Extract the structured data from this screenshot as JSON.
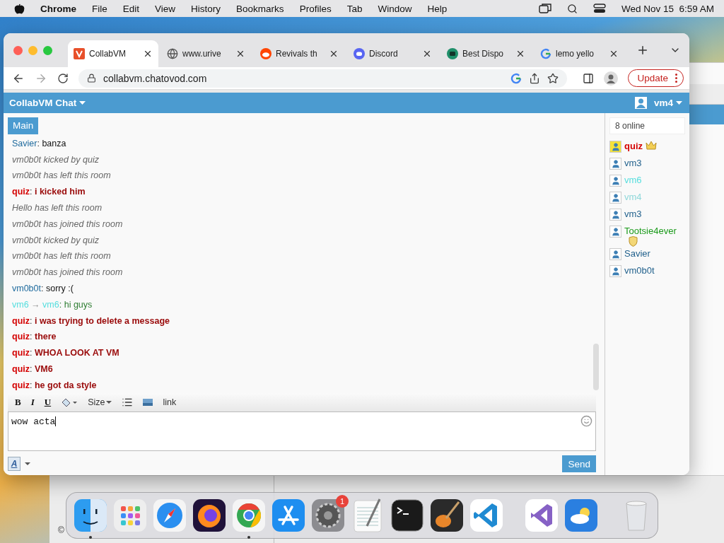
{
  "menubar": {
    "app": "Chrome",
    "menus": [
      "File",
      "Edit",
      "View",
      "History",
      "Bookmarks",
      "Profiles",
      "Tab",
      "Window",
      "Help"
    ],
    "clock": "Wed Nov 15  6:59 AM"
  },
  "browser": {
    "tabs": [
      {
        "title": "CollabVM",
        "kind": "collabvm",
        "selected": true
      },
      {
        "title": "www.urive",
        "kind": "globe",
        "selected": false
      },
      {
        "title": "Revivals th",
        "kind": "reddit",
        "selected": false
      },
      {
        "title": "Discord",
        "kind": "discord",
        "selected": false
      },
      {
        "title": "Best Dispo",
        "kind": "bot",
        "selected": false
      },
      {
        "title": "lemo yello",
        "kind": "google",
        "selected": false
      }
    ],
    "url": "collabvm.chatovod.com",
    "update_label": "Update"
  },
  "chat": {
    "title": "CollabVM Chat",
    "user": "vm4",
    "room_tabs": [
      {
        "label": "Main",
        "selected": true
      }
    ],
    "messages": [
      {
        "kind": "chat",
        "author": "Savier",
        "color": "#1f6b9e",
        "separator": ":",
        "text": "banza"
      },
      {
        "kind": "system",
        "text": "vm0b0t kicked by quiz"
      },
      {
        "kind": "system",
        "text": "vm0b0t has left this room"
      },
      {
        "kind": "admin",
        "author": "quiz",
        "color": "#d40000",
        "separator": ":",
        "text": "i kicked him"
      },
      {
        "kind": "system",
        "text": "Hello has left this room"
      },
      {
        "kind": "system",
        "text": "vm0b0t has joined this room"
      },
      {
        "kind": "system",
        "text": "vm0b0t kicked by quiz"
      },
      {
        "kind": "system",
        "text": "vm0b0t has left this room"
      },
      {
        "kind": "system",
        "text": "vm0b0t has joined this room"
      },
      {
        "kind": "chat",
        "author": "vm0b0t",
        "color": "#1f6b9e",
        "separator": ":",
        "text": "sorry :("
      },
      {
        "kind": "whisper",
        "author": "vm6",
        "arrow": "→",
        "recipient": "vm6",
        "color": "#55dede",
        "separator": ":",
        "text": "hi guys"
      },
      {
        "kind": "admin",
        "author": "quiz",
        "color": "#d40000",
        "separator": ":",
        "text": "i was trying to delete a message"
      },
      {
        "kind": "admin",
        "author": "quiz",
        "color": "#d40000",
        "separator": ":",
        "text": "there"
      },
      {
        "kind": "admin",
        "author": "quiz",
        "color": "#d40000",
        "separator": ":",
        "text": "WHOA LOOK AT VM"
      },
      {
        "kind": "admin",
        "author": "quiz",
        "color": "#d40000",
        "separator": ":",
        "text": "VM6"
      },
      {
        "kind": "admin",
        "author": "quiz",
        "color": "#d40000",
        "separator": ":",
        "text": "he got da style"
      }
    ],
    "format_buttons": [
      "B",
      "I",
      "U"
    ],
    "size_label": "Size",
    "link_label": "link",
    "input_value": "wow acta",
    "color_button": "A",
    "send_label": "Send",
    "online_count": "8 online",
    "users": [
      {
        "name": "quiz",
        "color": "#d40000",
        "kind": "owner"
      },
      {
        "name": "vm3",
        "color": "#1f5f8b",
        "kind": "user"
      },
      {
        "name": "vm6",
        "color": "#55dede",
        "kind": "user"
      },
      {
        "name": "vm4",
        "color": "#8fd8da",
        "kind": "user"
      },
      {
        "name": "vm3",
        "color": "#1f5f8b",
        "kind": "user"
      },
      {
        "name": "Tootsie4ever",
        "color": "#1a9a1a",
        "kind": "moderator"
      },
      {
        "name": "Savier",
        "color": "#1f5f8b",
        "kind": "user"
      },
      {
        "name": "vm0b0t",
        "color": "#1f5f8b",
        "kind": "user"
      }
    ]
  },
  "back_window": {
    "text": "©"
  },
  "dock": {
    "apps": [
      {
        "kind": "finder",
        "running": true
      },
      {
        "kind": "launchpad",
        "running": false
      },
      {
        "kind": "safari",
        "running": false
      },
      {
        "kind": "firefox",
        "running": false
      },
      {
        "kind": "chrome",
        "running": true
      },
      {
        "kind": "appstore",
        "running": false
      },
      {
        "kind": "settings",
        "running": false,
        "badge": "1"
      },
      {
        "kind": "textedit",
        "running": false
      },
      {
        "kind": "terminal",
        "running": false
      },
      {
        "kind": "guitar",
        "running": false
      },
      {
        "kind": "vscode",
        "running": false
      },
      {
        "kind": "separator"
      },
      {
        "kind": "visualstudio",
        "running": false
      },
      {
        "kind": "weather",
        "running": false
      },
      {
        "kind": "separator"
      },
      {
        "kind": "trash",
        "running": false
      }
    ]
  }
}
